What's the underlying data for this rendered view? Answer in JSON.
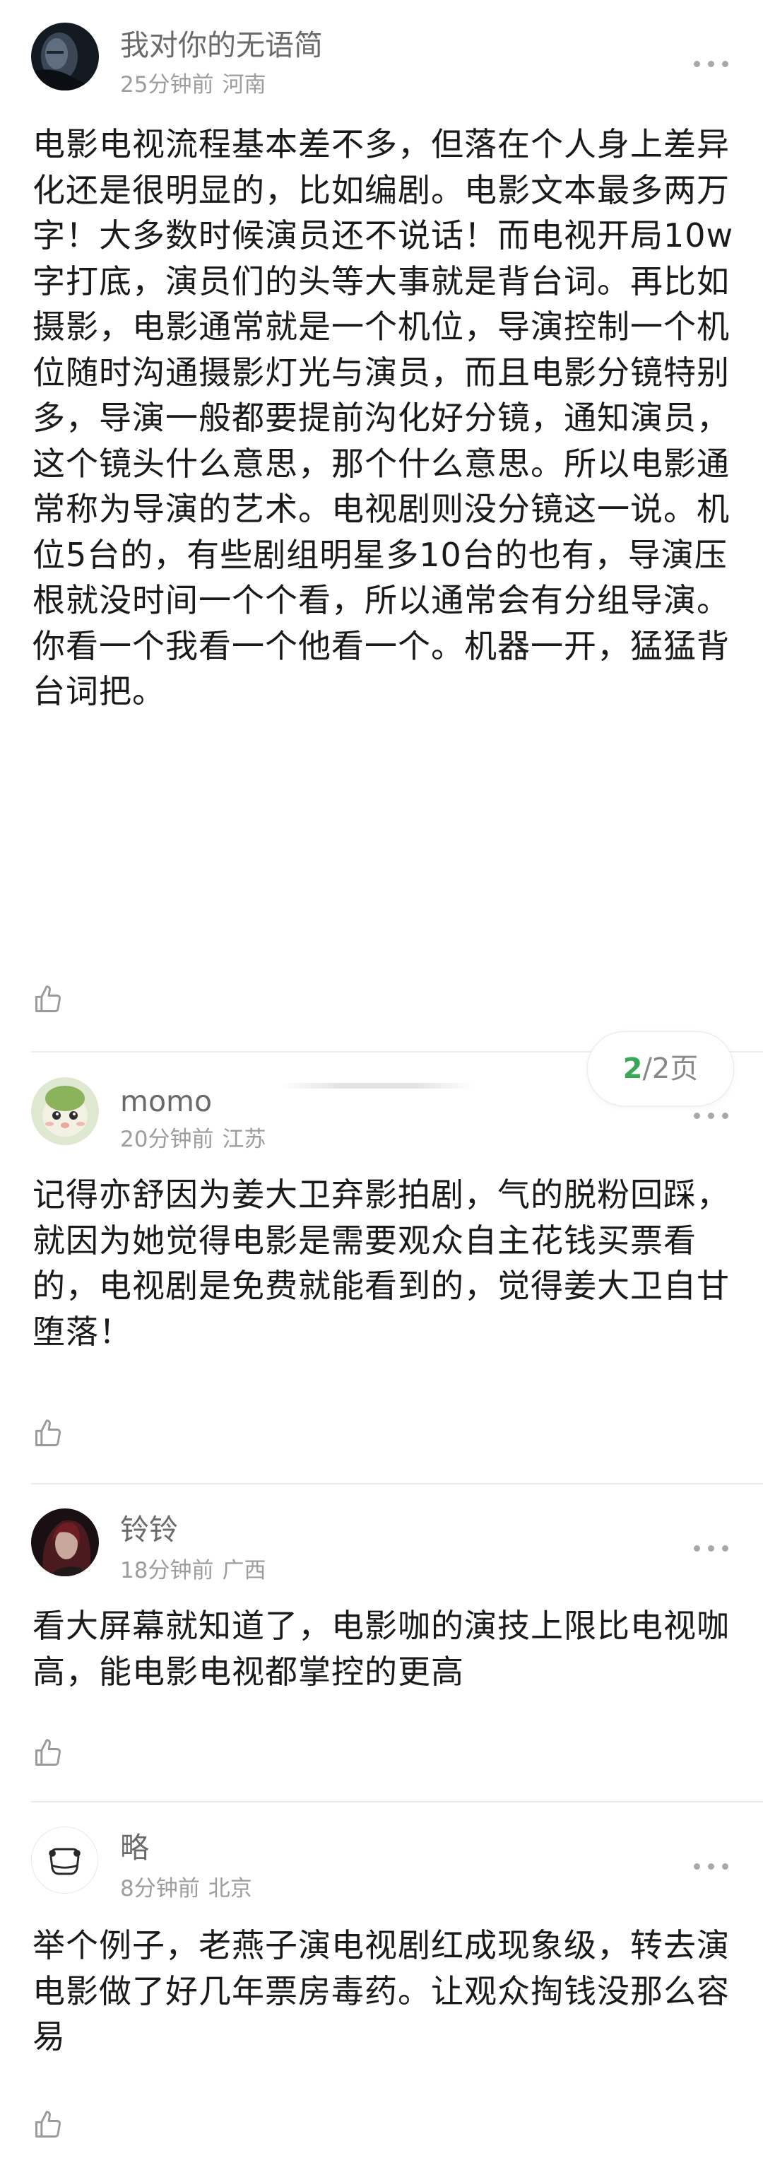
{
  "comments": [
    {
      "username": "我对你的无语简",
      "time": "25分钟前",
      "location": "河南",
      "content": "电影电视流程基本差不多，但落在个人身上差异化还是很明显的，比如编剧。电影文本最多两万字！大多数时候演员还不说话！而电视开局10w字打底，演员们的头等大事就是背台词。再比如摄影，电影通常就是一个机位，导演控制一个机位随时沟通摄影灯光与演员，而且电影分镜特别多，导演一般都要提前沟化好分镜，通知演员，这个镜头什么意思，那个什么意思。所以电影通常称为导演的艺术。电视剧则没分镜这一说。机位5台的，有些剧组明星多10台的也有，导演压根就没时间一个个看，所以通常会有分组导演。你看一个我看一个他看一个。机器一开，猛猛背台词把。"
    },
    {
      "username": "momo",
      "time": "20分钟前",
      "location": "江苏",
      "content": "记得亦舒因为姜大卫弃影拍剧，气的脱粉回踩，就因为她觉得电影是需要观众自主花钱买票看的，电视剧是免费就能看到的，觉得姜大卫自甘堕落！"
    },
    {
      "username": "铃铃",
      "time": "18分钟前",
      "location": "广西",
      "content": "看大屏幕就知道了，电影咖的演技上限比电视咖高，能电影电视都掌控的更高"
    },
    {
      "username": "略",
      "time": "8分钟前",
      "location": "北京",
      "content": "举个例子，老燕子演电视剧红成现象级，转去演电影做了好几年票房毒药。让观众掏钱没那么容易"
    }
  ],
  "pager": {
    "current": "2",
    "total_suffix": "/2页"
  },
  "colors": {
    "accent": "#3aa757",
    "username": "#6a6a6a",
    "meta": "#9d9d9d",
    "text": "#1a1a1a",
    "divider": "#ececec"
  },
  "icons": [
    "more-icon",
    "like-icon",
    "avatar"
  ]
}
